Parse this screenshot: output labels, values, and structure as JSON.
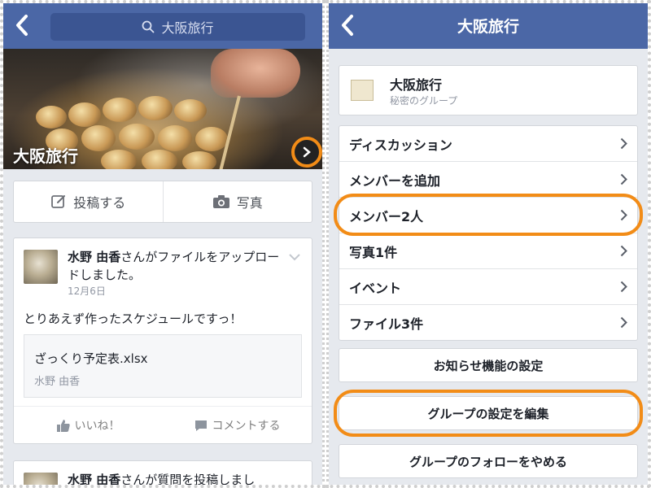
{
  "left": {
    "search": {
      "text": "大阪旅行",
      "icon": "search-icon"
    },
    "cover": {
      "title": "大阪旅行"
    },
    "actions": {
      "post_label": "投稿する",
      "photo_label": "写真"
    },
    "post1": {
      "author": "水野 由香",
      "action_text": "さんがファイルをアップロードしました。",
      "date": "12月6日",
      "body": "とりあえず作ったスケジュールですっ！",
      "attachment": {
        "name": "ざっくり予定表.xlsx",
        "owner": "水野 由香"
      },
      "like_label": "いいね！",
      "comment_label": "コメントする"
    },
    "post2": {
      "author": "水野 由香",
      "action_text": "さんが質問を投稿しまし"
    }
  },
  "right": {
    "title": "大阪旅行",
    "group": {
      "name": "大阪旅行",
      "type": "秘密のグループ"
    },
    "menu": [
      {
        "label": "ディスカッション"
      },
      {
        "label": "メンバーを追加"
      },
      {
        "label": "メンバー2人"
      },
      {
        "label": "写真1件"
      },
      {
        "label": "イベント"
      },
      {
        "label": "ファイル3件"
      }
    ],
    "notification_settings": "お知らせ機能の設定",
    "edit_group_settings": "グループの設定を編集",
    "unfollow_group": "グループのフォローをやめる"
  },
  "colors": {
    "navbar": "#4b67a6",
    "highlight": "#f28c17",
    "background": "#e6e9ee"
  }
}
